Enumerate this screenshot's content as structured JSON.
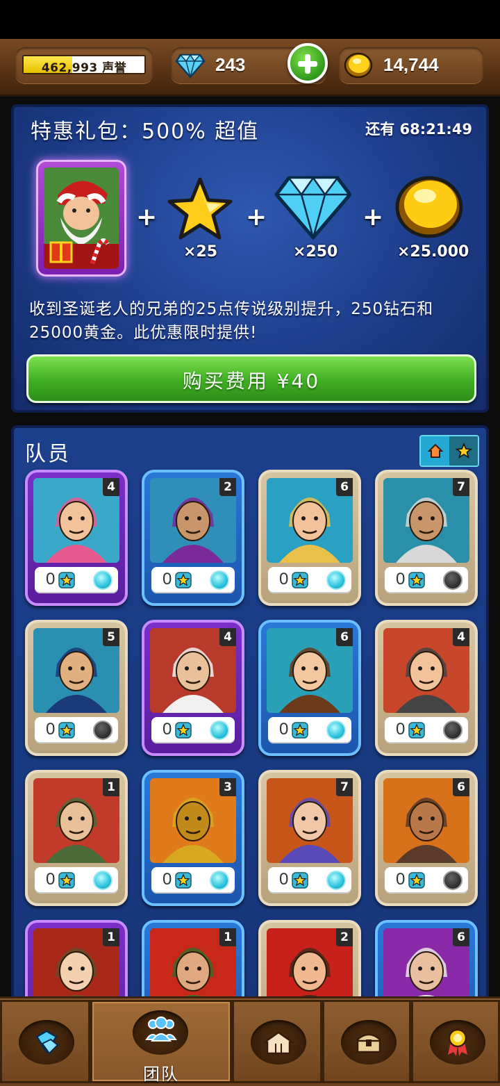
{
  "top_bar": {
    "reputation": {
      "value": "462,993",
      "label": "声誉",
      "progress_fraction": 0.4
    },
    "gems": {
      "value": "243"
    },
    "gold": {
      "value": "14,744"
    }
  },
  "offer": {
    "title": "特惠礼包：500% 超值",
    "timer": "还有 68:21:49",
    "rewards": [
      {
        "icon": "star-icon",
        "quantity": "×25"
      },
      {
        "icon": "diamond-icon",
        "quantity": "×250"
      },
      {
        "icon": "gold-coin-icon",
        "quantity": "×25.000"
      }
    ],
    "description": "收到圣诞老人的兄弟的25点传说级别提升，250钻石和25000黄金。此优惠限时提供!",
    "buy_label": "购买费用 ¥40"
  },
  "team": {
    "title": "队员",
    "heroes": [
      {
        "name": "elf-alchemist",
        "level": "4",
        "stars": "0",
        "rarity": "purple",
        "dot": "on"
      },
      {
        "name": "bearded-mage",
        "level": "2",
        "stars": "0",
        "rarity": "blue",
        "dot": "on"
      },
      {
        "name": "potion-maiden",
        "level": "6",
        "stars": "0",
        "rarity": "tan",
        "dot": "on"
      },
      {
        "name": "old-hermit",
        "level": "7",
        "stars": "0",
        "rarity": "tan",
        "dot": "off"
      },
      {
        "name": "monocle-general",
        "level": "5",
        "stars": "0",
        "rarity": "tan",
        "dot": "off"
      },
      {
        "name": "butcher-chef",
        "level": "4",
        "stars": "0",
        "rarity": "purple",
        "dot": "on"
      },
      {
        "name": "baker-woman",
        "level": "6",
        "stars": "0",
        "rarity": "blue",
        "dot": "on"
      },
      {
        "name": "barmaid",
        "level": "4",
        "stars": "0",
        "rarity": "tan",
        "dot": "off"
      },
      {
        "name": "old-hunter",
        "level": "1",
        "stars": "0",
        "rarity": "tan",
        "dot": "on"
      },
      {
        "name": "golden-knight",
        "level": "3",
        "stars": "0",
        "rarity": "blue",
        "dot": "on"
      },
      {
        "name": "elf-craftsman",
        "level": "7",
        "stars": "0",
        "rarity": "tan",
        "dot": "on"
      },
      {
        "name": "strongman",
        "level": "6",
        "stars": "0",
        "rarity": "tan",
        "dot": "off"
      },
      {
        "name": "scared-boy",
        "level": "1",
        "stars": "",
        "rarity": "purple",
        "dot": ""
      },
      {
        "name": "hooded-ranger",
        "level": "1",
        "stars": "",
        "rarity": "blue",
        "dot": ""
      },
      {
        "name": "red-lady",
        "level": "2",
        "stars": "",
        "rarity": "tan",
        "dot": ""
      },
      {
        "name": "white-wizard",
        "level": "6",
        "stars": "",
        "rarity": "blue",
        "dot": ""
      }
    ]
  },
  "bottom_nav": {
    "tabs": [
      {
        "icon": "gems-shop-icon",
        "label": ""
      },
      {
        "icon": "team-icon",
        "label": "团队"
      },
      {
        "icon": "buildings-icon",
        "label": ""
      },
      {
        "icon": "chest-icon",
        "label": ""
      },
      {
        "icon": "achievement-icon",
        "label": ""
      }
    ]
  },
  "colors": {
    "purple_card": "#7b2fc8",
    "blue_card": "#2a78d8",
    "tan_card": "#d8c5a2",
    "buy_green": "#3fae24",
    "panel_blue": "#1c3f8c"
  }
}
